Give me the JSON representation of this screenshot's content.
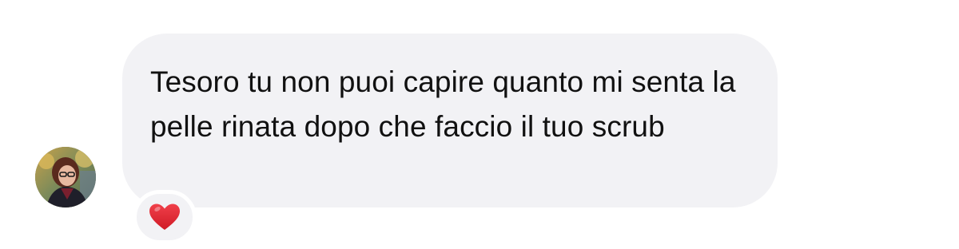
{
  "message": {
    "text": "Tesoro tu non puoi capire quanto mi senta la pelle rinata dopo che faccio il tuo scrub",
    "bubble_color": "#f2f2f5",
    "text_color": "#111111"
  },
  "reaction": {
    "icon": "red-heart-icon",
    "color": "#e0242f"
  },
  "sender": {
    "avatar": "avatar-photo"
  }
}
